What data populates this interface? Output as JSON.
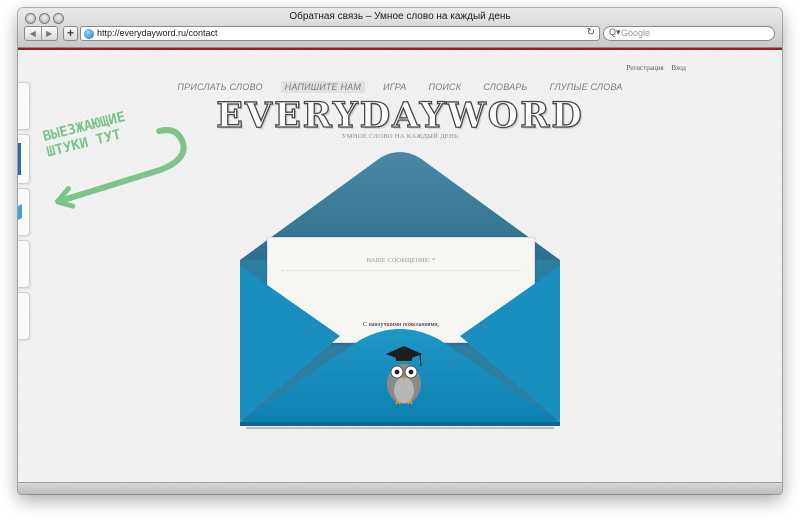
{
  "browser": {
    "title": "Обратная связь – Умное слово на каждый день",
    "url": "http://everydayword.ru/contact",
    "search_placeholder": "Google",
    "back_glyph": "◀",
    "forward_glyph": "▶",
    "add_glyph": "+",
    "reload_glyph": "↻",
    "search_glyph": "Q▾"
  },
  "auth": {
    "register": "Регистрация",
    "login": "Вход"
  },
  "menu": {
    "items": [
      {
        "label": "ПРИСЛАТЬ СЛОВО"
      },
      {
        "label": "НАПИШИТЕ НАМ"
      },
      {
        "label": "ИГРА"
      },
      {
        "label": "ПОИСК"
      },
      {
        "label": "СЛОВАРЬ"
      },
      {
        "label": "ГЛУПЫЕ СЛОВА"
      }
    ]
  },
  "logo": {
    "text": "EVERYDAYWORD",
    "tagline": "УМНОЕ СЛОВО НА КАЖДЫЙ ДЕНЬ"
  },
  "stamp": {
    "line1": "ВЫЕЗЖАЮЩИЕ",
    "line2": "ШТУКИ ТУТ"
  },
  "form": {
    "message_label": "ВАШЕ СООБЩЕНИЕ: *",
    "signature": "С наилучшими пожеланиями,"
  },
  "colors": {
    "envelope_blue": "#1a8fbf",
    "envelope_dark": "#0f6f98",
    "flap_back": "#3d7f9c",
    "accent_line": "#9b1d1d",
    "stamp_green": "#7cc38c"
  }
}
